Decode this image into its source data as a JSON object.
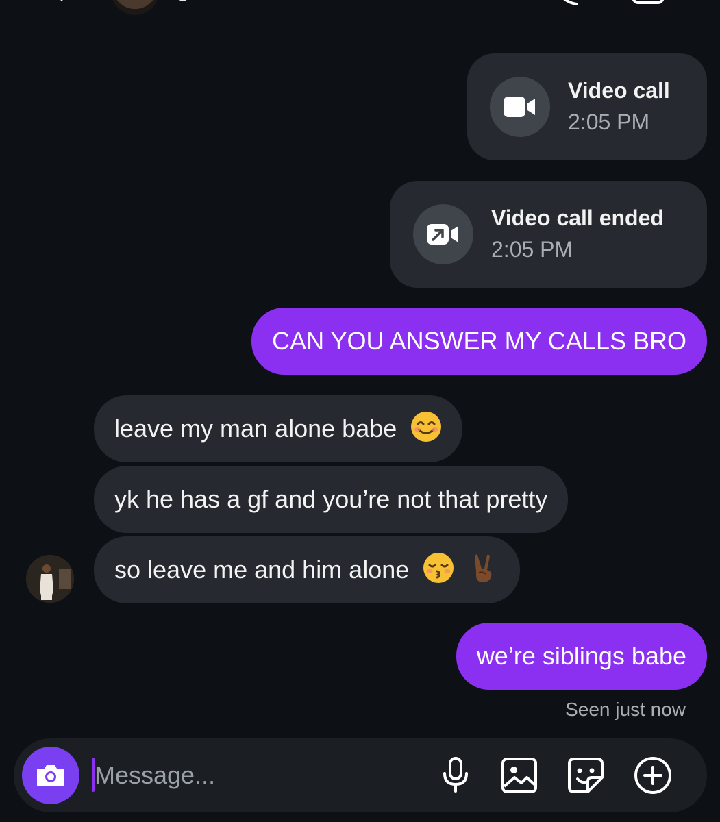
{
  "header": {
    "back_icon": "chevron-left-icon",
    "call_icon": "phone-icon",
    "video_icon": "video-camera-icon"
  },
  "thread": {
    "calls": [
      {
        "title": "Video call",
        "time": "2:05 PM",
        "icon": "video-camera-icon"
      },
      {
        "title": "Video call ended",
        "time": "2:05 PM",
        "icon": "video-call-ended-icon"
      }
    ],
    "messages": [
      {
        "direction": "sent",
        "text": "CAN YOU ANSWER MY CALLS BRO"
      },
      {
        "direction": "received",
        "text": "leave my man alone babe"
      },
      {
        "direction": "received",
        "text": "yk he has a gf and you’re not that pretty"
      },
      {
        "direction": "received",
        "text": "so leave me and him alone"
      },
      {
        "direction": "sent",
        "text": "we’re siblings babe"
      }
    ],
    "seen_status": "Seen just now"
  },
  "composer": {
    "placeholder": "Message...",
    "camera_icon": "camera-icon",
    "mic_icon": "microphone-icon",
    "gallery_icon": "image-icon",
    "sticker_icon": "sticker-icon",
    "plus_icon": "plus-circle-icon"
  },
  "colors": {
    "background": "#0d1015",
    "sent_bubble": "#8b2ff0",
    "received_bubble": "#26292f",
    "accent_camera": "#7b3ff2"
  }
}
